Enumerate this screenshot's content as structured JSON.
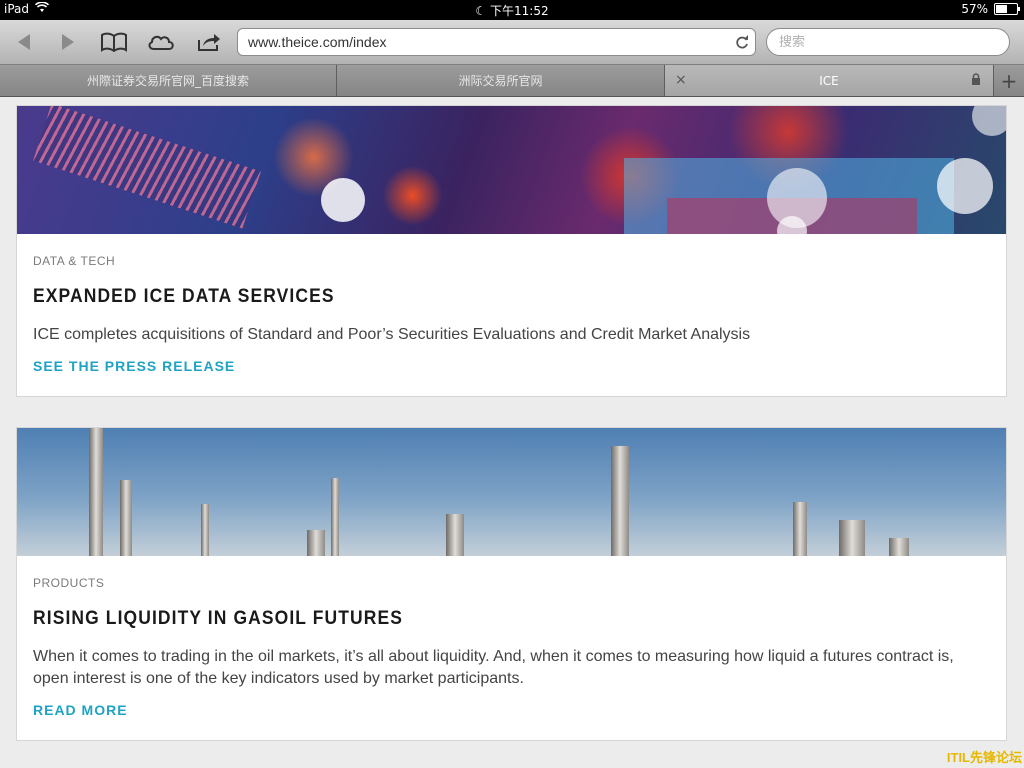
{
  "status_bar": {
    "device": "iPad",
    "time": "下午11:52",
    "battery": "57%",
    "battery_level": 0.57
  },
  "toolbar": {
    "url": "www.theice.com/index",
    "search_placeholder": "搜索"
  },
  "tabs": [
    {
      "label": "州際证券交易所官网_百度搜索"
    },
    {
      "label": "洲际交易所官网"
    },
    {
      "label": "ICE"
    }
  ],
  "cards": [
    {
      "category": "DATA & TECH",
      "headline": "EXPANDED ICE DATA SERVICES",
      "description": "ICE completes acquisitions of Standard and Poor’s Securities Evaluations and Credit Market Analysis",
      "cta": "SEE THE PRESS RELEASE"
    },
    {
      "category": "PRODUCTS",
      "headline": "RISING LIQUIDITY IN GASOIL FUTURES",
      "description": "When it comes to trading in the oil markets, it’s all about liquidity. And, when it comes to measuring how liquid a futures contract is, open interest is one of the key indicators used by market participants.",
      "cta": "READ MORE"
    }
  ],
  "watermark": "ITIL先锋论坛",
  "colors": {
    "accent": "#1fa3c4",
    "headline": "#1a1a1a",
    "background": "#ececec"
  }
}
